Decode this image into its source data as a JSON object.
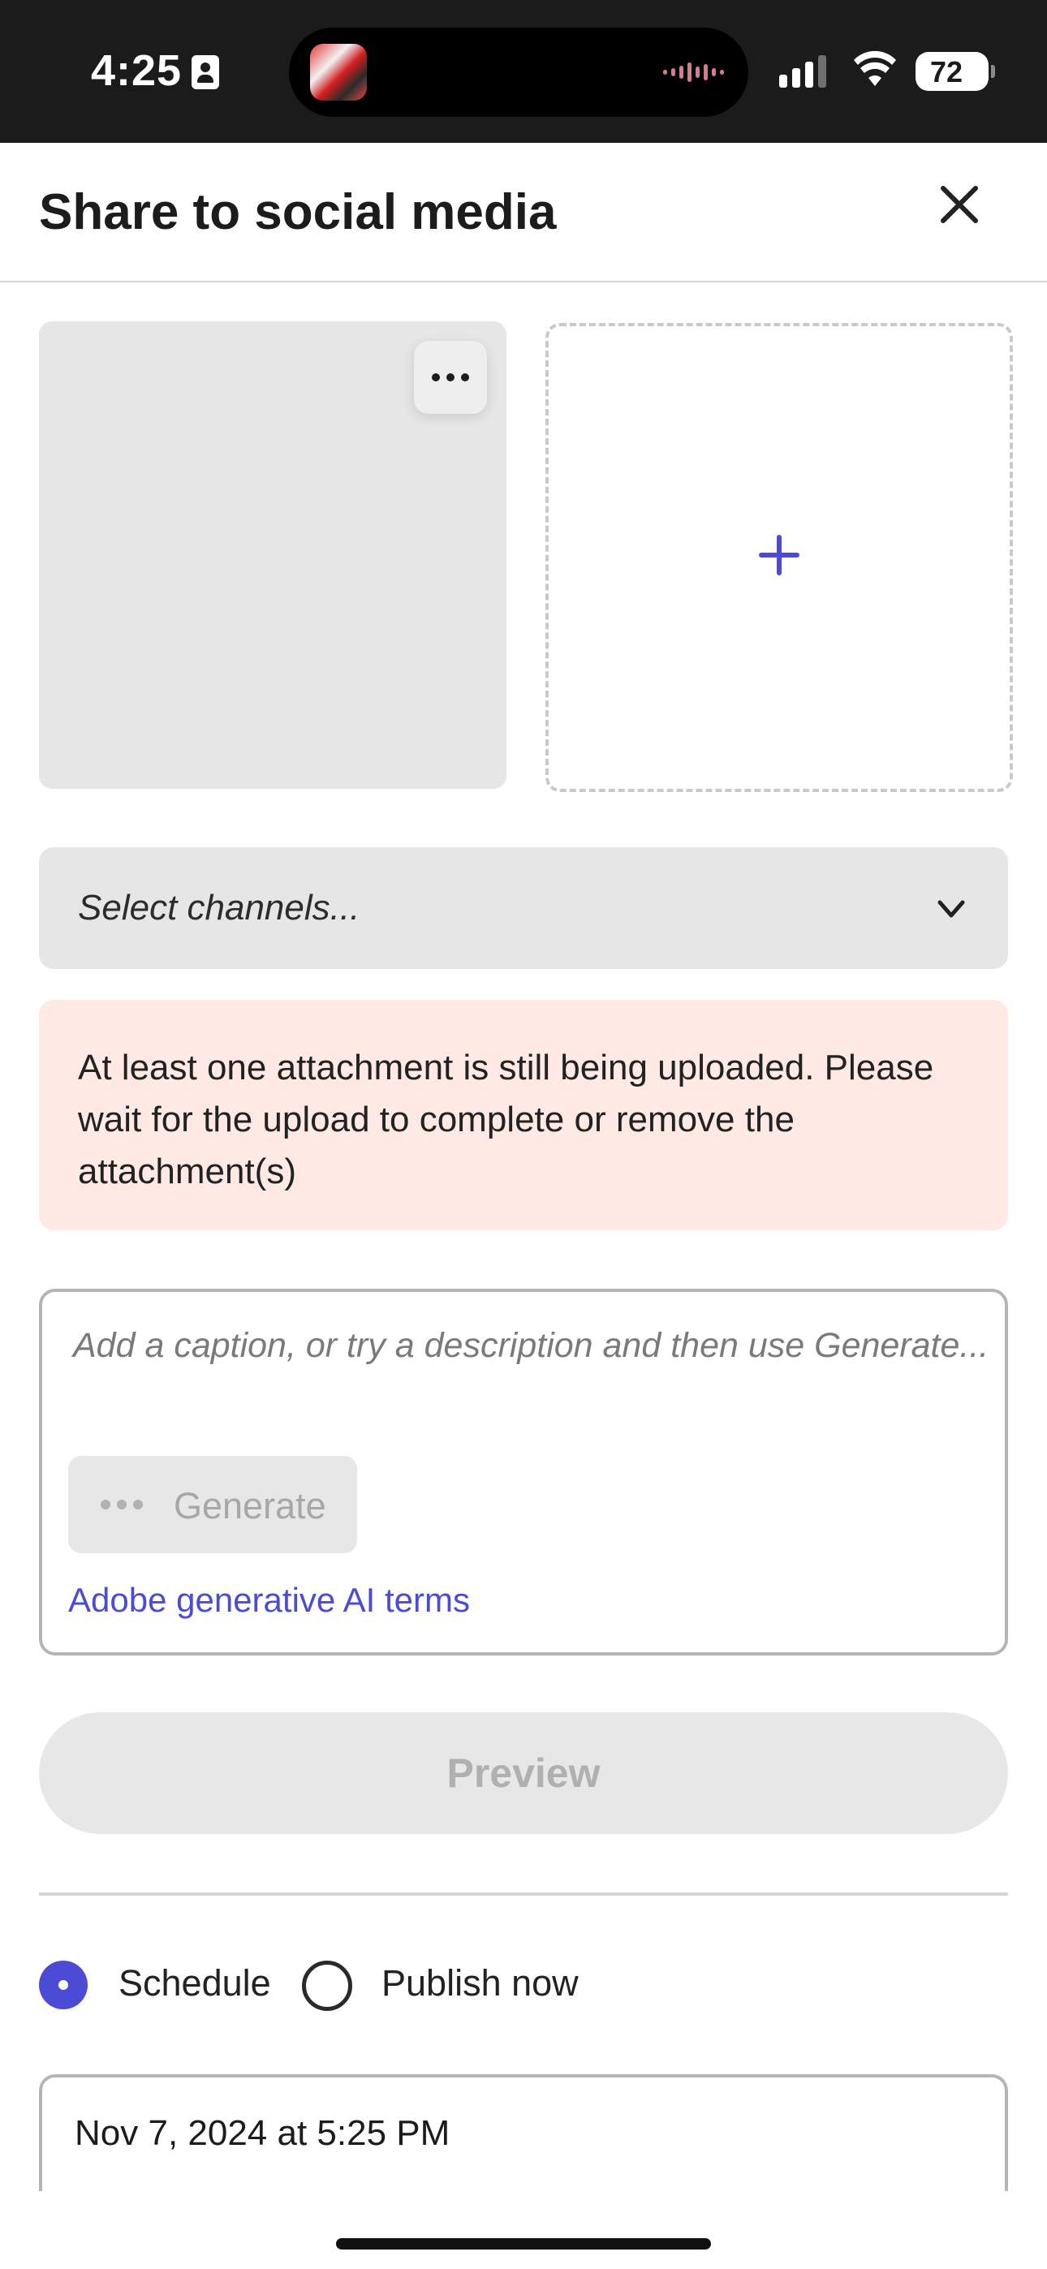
{
  "status_bar": {
    "time": "4:25",
    "battery": "72"
  },
  "header": {
    "title": "Share to social media",
    "close_icon": "close-icon"
  },
  "media": {
    "more_icon": "more-horizontal-icon",
    "add_icon": "plus-icon"
  },
  "channels": {
    "placeholder": "Select channels...",
    "chevron_icon": "chevron-down-icon"
  },
  "alert": {
    "message": "At least one attachment is still being uploaded. Please wait for the upload to complete or remove the attachment(s)",
    "background": "#ffe9e4"
  },
  "caption": {
    "placeholder": "Add a caption, or try a description and then use Generate...",
    "generate_label": "Generate",
    "ai_terms_link": "Adobe generative AI terms"
  },
  "preview": {
    "label": "Preview"
  },
  "publish_mode": {
    "options": [
      {
        "label": "Schedule",
        "selected": true
      },
      {
        "label": "Publish now",
        "selected": false
      }
    ]
  },
  "schedule": {
    "datetime": "Nov 7, 2024 at 5:25 PM"
  },
  "colors": {
    "accent": "#4b4bd6",
    "status_bar_bg": "#1b1b1b"
  }
}
